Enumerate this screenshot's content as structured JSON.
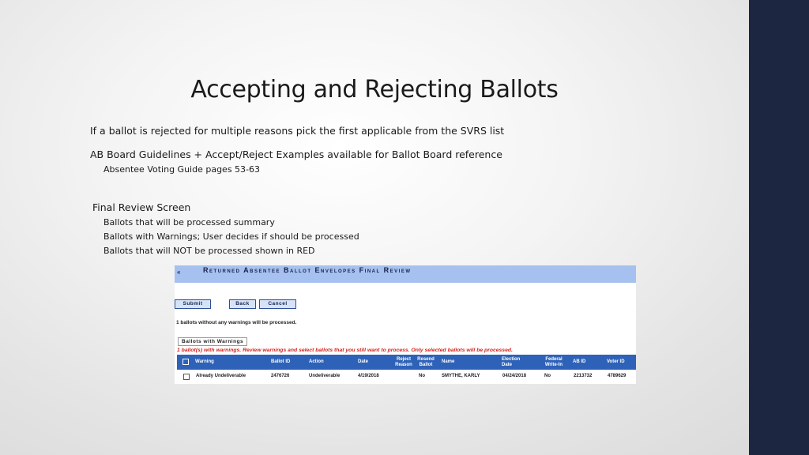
{
  "slide": {
    "title": "Accepting and Rejecting Ballots",
    "line1": "If a ballot is rejected for multiple reasons pick the first applicable from the SVRS list",
    "line2": "AB Board Guidelines + Accept/Reject Examples available for Ballot Board reference",
    "line2_sub": "Absentee Voting Guide pages 53-63",
    "line3": "Final Review Screen",
    "line3_subs": [
      "Ballots that will be processed summary",
      "Ballots with Warnings; User decides if should be processed",
      "Ballots that will NOT be processed shown in RED"
    ],
    "colors": {
      "sidebar": "#1c2640",
      "header_bar": "#a6c1ef",
      "table_header": "#2e62b8",
      "warning_text": "#d4221c"
    }
  },
  "screenshot": {
    "collapse_icon": "«",
    "header_title": "Returned Absentee Ballot Envelopes Final Review",
    "buttons": {
      "submit": "Submit",
      "back": "Back",
      "cancel": "Cancel"
    },
    "info_text": "1 ballots without any warnings will be processed.",
    "section_title": "Ballots with Warnings",
    "warning_text": "1 ballot(s) with warnings. Review warnings and select ballots that you still want to process. Only selected ballots will be processed.",
    "columns": [
      "Warning",
      "Ballot ID",
      "Action",
      "Date",
      "Reject Reason",
      "Resend Ballot",
      "Name",
      "Election Date",
      "Federal Write-In",
      "AB ID",
      "Voter ID"
    ],
    "rows": [
      {
        "warning": "Already Undeliverable",
        "ballot_id": "2476726",
        "action": "Undeliverable",
        "date": "4/19/2018",
        "reject_reason": "",
        "resend_ballot": "No",
        "name": "SMYTHE, KARLY",
        "election_date": "04/24/2018",
        "federal_write_in": "No",
        "ab_id": "2213732",
        "voter_id": "4789629"
      }
    ]
  }
}
